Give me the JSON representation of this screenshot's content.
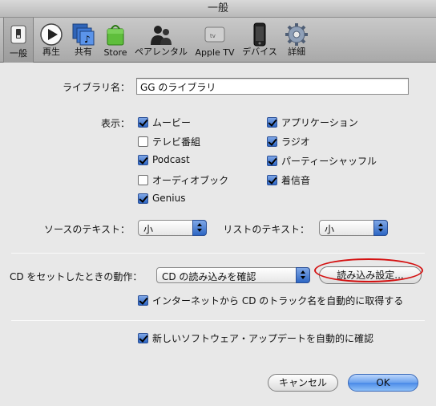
{
  "window": {
    "title": "一般"
  },
  "toolbar": {
    "items": [
      {
        "label": "一般",
        "icon": "general-switch-icon"
      },
      {
        "label": "再生",
        "icon": "play-icon"
      },
      {
        "label": "共有",
        "icon": "share-icon"
      },
      {
        "label": "Store",
        "icon": "store-bag-icon"
      },
      {
        "label": "ペアレンタル",
        "icon": "parental-icon"
      },
      {
        "label": "Apple TV",
        "icon": "apple-tv-icon"
      },
      {
        "label": "デバイス",
        "icon": "device-icon"
      },
      {
        "label": "詳細",
        "icon": "gear-icon"
      }
    ]
  },
  "library": {
    "label": "ライブラリ名：",
    "value": "GG のライブラリ"
  },
  "show": {
    "label": "表示：",
    "left": [
      {
        "label": "ムービー",
        "checked": true
      },
      {
        "label": "テレビ番組",
        "checked": false
      },
      {
        "label": "Podcast",
        "checked": true
      },
      {
        "label": "オーディオブック",
        "checked": false
      },
      {
        "label": "Genius",
        "checked": true
      }
    ],
    "right": [
      {
        "label": "アプリケーション",
        "checked": true
      },
      {
        "label": "ラジオ",
        "checked": true
      },
      {
        "label": "パーティーシャッフル",
        "checked": true
      },
      {
        "label": "着信音",
        "checked": true
      }
    ]
  },
  "text_size": {
    "source_label": "ソースのテキスト：",
    "source_value": "小",
    "list_label": "リストのテキスト：",
    "list_value": "小"
  },
  "cd": {
    "label": "CD をセットしたときの動作：",
    "value": "CD の読み込みを確認",
    "import_button": "読み込み設定...",
    "auto_names": {
      "label": "インターネットから CD のトラック名を自動的に取得する",
      "checked": true
    }
  },
  "update": {
    "label": "新しいソフトウェア・アップデートを自動的に確認",
    "checked": true
  },
  "buttons": {
    "cancel": "キャンセル",
    "ok": "OK"
  },
  "colors": {
    "accent": "#4a8ae8",
    "highlight_oval": "#d41212"
  }
}
